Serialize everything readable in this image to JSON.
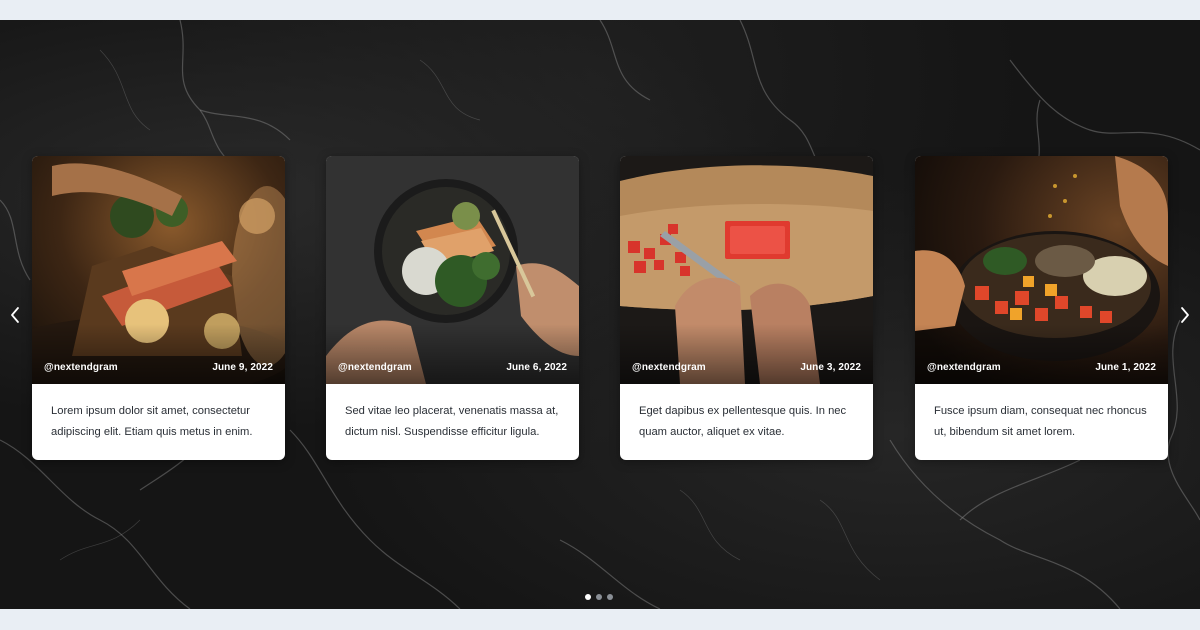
{
  "slider": {
    "prev_icon": "chevron-left-icon",
    "next_icon": "chevron-right-icon",
    "slides": [
      {
        "handle": "@nextendgram",
        "date": "June 9, 2022",
        "text": "Lorem ipsum dolor sit amet, consectetur adipiscing elit. Etiam quis metus in enim."
      },
      {
        "handle": "@nextendgram",
        "date": "June 6, 2022",
        "text": "Sed vitae leo placerat, venenatis massa at, dictum nisl. Suspendisse efficitur ligula."
      },
      {
        "handle": "@nextendgram",
        "date": "June 3, 2022",
        "text": "Eget dapibus ex pellentesque quis. In nec quam auctor, aliquet ex vitae."
      },
      {
        "handle": "@nextendgram",
        "date": "June 1, 2022",
        "text": "Fusce ipsum diam, consequat nec rhoncus ut, bibendum sit amet lorem."
      }
    ],
    "pagination": {
      "count": 3,
      "active": 1
    }
  }
}
